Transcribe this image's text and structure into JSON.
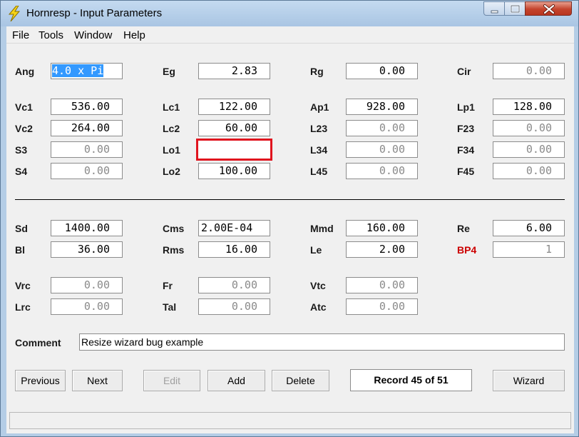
{
  "window": {
    "title": "Hornresp - Input Parameters"
  },
  "menu": {
    "file": "File",
    "tools": "Tools",
    "window": "Window",
    "help": "Help"
  },
  "fields": {
    "Ang": {
      "label": "Ang",
      "value": "4.0 x Pi"
    },
    "Eg": {
      "label": "Eg",
      "value": "2.83"
    },
    "Rg": {
      "label": "Rg",
      "value": "0.00"
    },
    "Cir": {
      "label": "Cir",
      "value": "0.00"
    },
    "Vc1": {
      "label": "Vc1",
      "value": "536.00"
    },
    "Lc1": {
      "label": "Lc1",
      "value": "122.00"
    },
    "Ap1": {
      "label": "Ap1",
      "value": "928.00"
    },
    "Lp1": {
      "label": "Lp1",
      "value": "128.00"
    },
    "Vc2": {
      "label": "Vc2",
      "value": "264.00"
    },
    "Lc2": {
      "label": "Lc2",
      "value": "60.00"
    },
    "L23": {
      "label": "L23",
      "value": "0.00"
    },
    "F23": {
      "label": "F23",
      "value": "0.00"
    },
    "S3": {
      "label": "S3",
      "value": "0.00"
    },
    "Lo1": {
      "label": "Lo1",
      "value": ""
    },
    "L34": {
      "label": "L34",
      "value": "0.00"
    },
    "F34": {
      "label": "F34",
      "value": "0.00"
    },
    "S4": {
      "label": "S4",
      "value": "0.00"
    },
    "Lo2": {
      "label": "Lo2",
      "value": "100.00"
    },
    "L45": {
      "label": "L45",
      "value": "0.00"
    },
    "F45": {
      "label": "F45",
      "value": "0.00"
    },
    "Sd": {
      "label": "Sd",
      "value": "1400.00"
    },
    "Cms": {
      "label": "Cms",
      "value": "2.00E-04"
    },
    "Mmd": {
      "label": "Mmd",
      "value": "160.00"
    },
    "Re": {
      "label": "Re",
      "value": "6.00"
    },
    "Bl": {
      "label": "Bl",
      "value": "36.00"
    },
    "Rms": {
      "label": "Rms",
      "value": "16.00"
    },
    "Le": {
      "label": "Le",
      "value": "2.00"
    },
    "BP4": {
      "label": "BP4",
      "value": "1"
    },
    "Vrc": {
      "label": "Vrc",
      "value": "0.00"
    },
    "Fr": {
      "label": "Fr",
      "value": "0.00"
    },
    "Vtc": {
      "label": "Vtc",
      "value": "0.00"
    },
    "Lrc": {
      "label": "Lrc",
      "value": "0.00"
    },
    "Tal": {
      "label": "Tal",
      "value": "0.00"
    },
    "Atc": {
      "label": "Atc",
      "value": "0.00"
    }
  },
  "comment": {
    "label": "Comment",
    "value": "Resize wizard bug example"
  },
  "buttons": {
    "previous": "Previous",
    "next": "Next",
    "edit": "Edit",
    "add": "Add",
    "delete": "Delete",
    "wizard": "Wizard"
  },
  "record": "Record 45 of 51",
  "colors": {
    "highlight": "#e0141e",
    "bp4_label": "#cc0000",
    "selection": "#3399ff"
  }
}
